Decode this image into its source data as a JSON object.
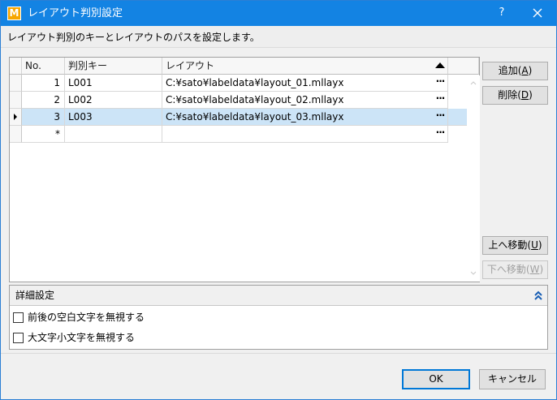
{
  "window": {
    "title": "レイアウト判別設定",
    "app_icon_letter": "M",
    "help_label": "?",
    "accent_color": "#1383e3"
  },
  "description": "レイアウト判別のキーとレイアウトのパスを設定します。",
  "grid": {
    "columns": [
      "No.",
      "判別キー",
      "レイアウト"
    ],
    "sort": "descending-icon-on-layout",
    "rows": [
      {
        "no": "1",
        "key": "L001",
        "layout": "C:¥sato¥labeldata¥layout_01.mllayx",
        "ellipsis": "···"
      },
      {
        "no": "2",
        "key": "L002",
        "layout": "C:¥sato¥labeldata¥layout_02.mllayx",
        "ellipsis": "···"
      },
      {
        "no": "3",
        "key": "L003",
        "layout": "C:¥sato¥labeldata¥layout_03.mllayx",
        "ellipsis": "···"
      }
    ],
    "new_row": {
      "marker": "*",
      "ellipsis": "···"
    },
    "selected_row": 3
  },
  "buttons": {
    "add": {
      "label": "追加(",
      "key": "A",
      "close": ")"
    },
    "delete": {
      "label": "削除(",
      "key": "D",
      "close": ")"
    },
    "move_up": {
      "label": "上へ移動(",
      "key": "U",
      "close": ")"
    },
    "move_down": {
      "label": "下へ移動(",
      "key": "W",
      "close": ")"
    },
    "ok": "OK",
    "cancel": "キャンセル"
  },
  "details": {
    "title": "詳細設定",
    "options": [
      {
        "label": "前後の空白文字を無視する",
        "checked": false
      },
      {
        "label": "大文字小文字を無視する",
        "checked": false
      }
    ]
  }
}
